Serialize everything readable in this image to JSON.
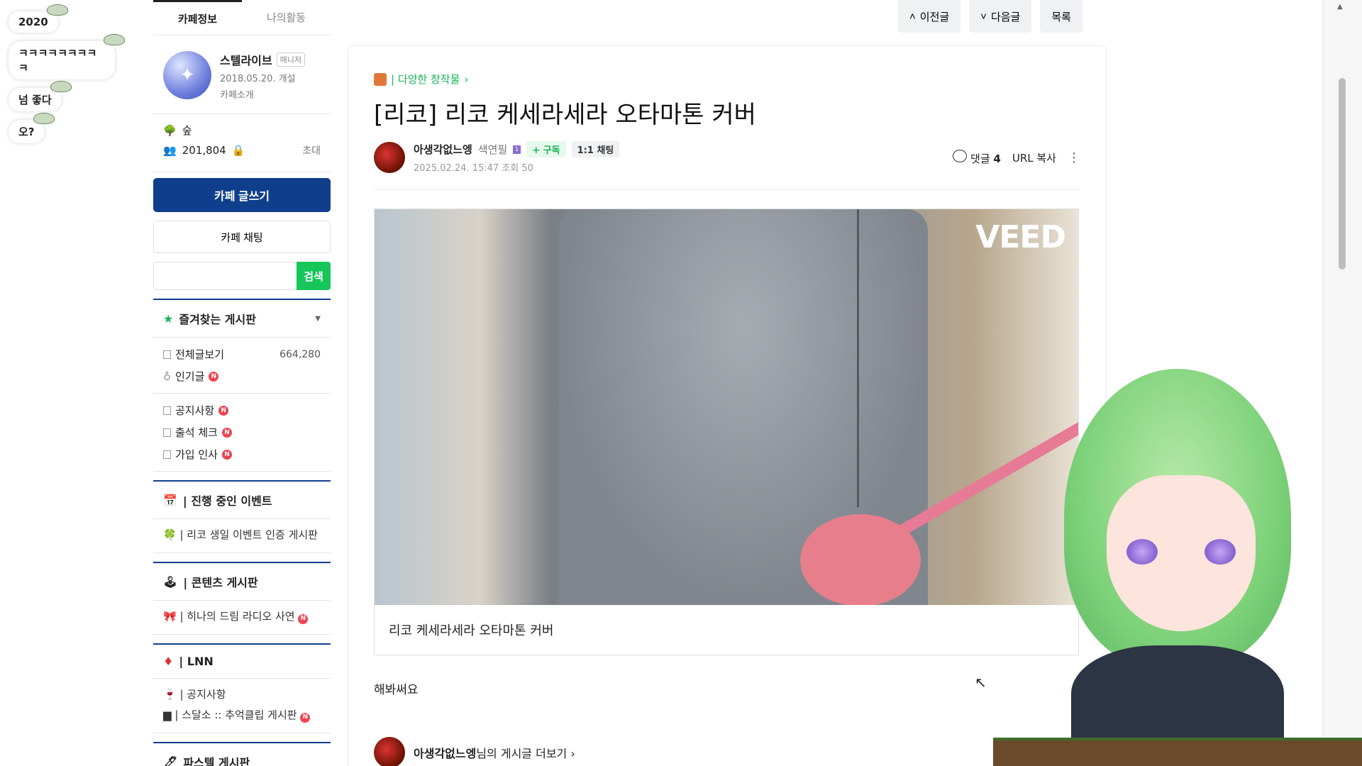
{
  "chat": [
    "2020",
    "ㅋㅋㅋㅋㅋㅋㅋㅋㅋ",
    "넘 좋다",
    "오?"
  ],
  "sidebar": {
    "tabs": [
      "카페정보",
      "나의활동"
    ],
    "profile": {
      "name": "스텔라이브",
      "role": "매니저",
      "date": "2018.05.20. 개설",
      "intro": "카페소개"
    },
    "level": "숲",
    "members": "201,804",
    "invite": "초대",
    "write_label": "카페 글쓰기",
    "chat_label": "카페 채팅",
    "search_label": "검색",
    "favorites_title": "즐겨찾는 게시판",
    "items_all": "전체글보기",
    "items_all_count": "664,280",
    "items_popular": "인기글",
    "notice": "공지사항",
    "attendance": "출석 체크",
    "greeting": "가입 인사",
    "events_title": "| 진행 중인 이벤트",
    "events_item": "| 리코 생일 이벤트 인증 게시판",
    "contents_title": "| 콘텐츠 게시판",
    "contents_item": "| 히나의 드림 라디오 사연",
    "lnn_title": "| LNN",
    "lnn_item1": "| 공지사항",
    "lnn_item2": "| 스달소 :: 추억클립 게시판",
    "pastel_title": "파스텔 게시판"
  },
  "nav": {
    "prev": "이전글",
    "next": "다음글",
    "list": "목록"
  },
  "article": {
    "breadcrumb": "| 다양한 창작물",
    "title": "[리코] 리코 케세라세라 오타마톤 커버",
    "author": "아생각없느엥",
    "rank": "색연필",
    "subscribe": "+ 구독",
    "chat": "1:1 채팅",
    "date": "2025.02.24. 15:47",
    "views": "조회 50",
    "comments_label": "댓글",
    "comments_count": "4",
    "url_copy": "URL 복사",
    "watermark": "VEED",
    "caption": "리코 케세라세라 오타마톤 커버",
    "body": "해봐써요",
    "more_author": "아생각없느엥",
    "more_suffix": "님의 게시글 더보기 ›"
  }
}
